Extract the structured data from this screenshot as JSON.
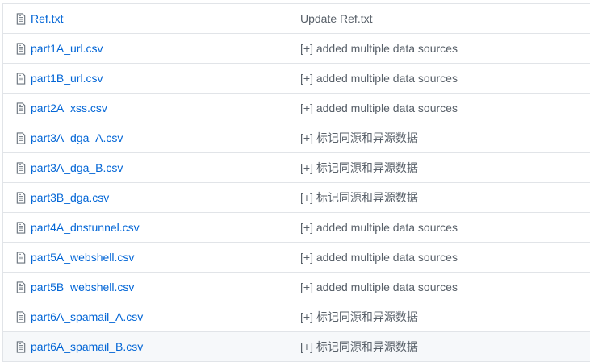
{
  "files": [
    {
      "name": "Ref.txt",
      "message": "Update Ref.txt"
    },
    {
      "name": "part1A_url.csv",
      "message": "[+] added multiple data sources"
    },
    {
      "name": "part1B_url.csv",
      "message": "[+] added multiple data sources"
    },
    {
      "name": "part2A_xss.csv",
      "message": "[+] added multiple data sources"
    },
    {
      "name": "part3A_dga_A.csv",
      "message": "[+] 标记同源和异源数据"
    },
    {
      "name": "part3A_dga_B.csv",
      "message": "[+] 标记同源和异源数据"
    },
    {
      "name": "part3B_dga.csv",
      "message": "[+] 标记同源和异源数据"
    },
    {
      "name": "part4A_dnstunnel.csv",
      "message": "[+] added multiple data sources"
    },
    {
      "name": "part5A_webshell.csv",
      "message": "[+] added multiple data sources"
    },
    {
      "name": "part5B_webshell.csv",
      "message": "[+] added multiple data sources"
    },
    {
      "name": "part6A_spamail_A.csv",
      "message": "[+] 标记同源和异源数据"
    },
    {
      "name": "part6A_spamail_B.csv",
      "message": "[+] 标记同源和异源数据"
    }
  ],
  "icon": "file-text-icon",
  "colors": {
    "link": "#0366d6",
    "message": "#586069",
    "hover_row": "#f6f8fa",
    "border": "#e1e4e8"
  }
}
